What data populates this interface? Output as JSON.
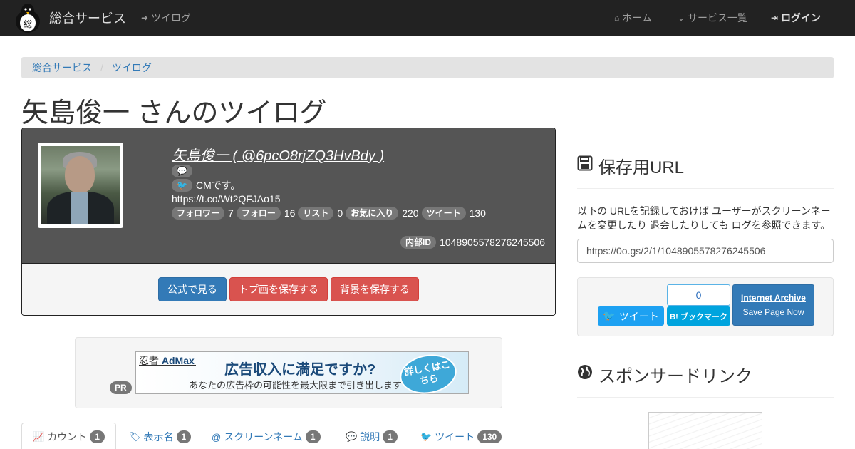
{
  "navbar": {
    "brand": "総合サービス",
    "logo_char": "総",
    "section_link": "ツイログ",
    "home": "ホーム",
    "services": "サービス一覧",
    "login": "ログイン"
  },
  "breadcrumb": {
    "root": "総合サービス",
    "current": "ツイログ"
  },
  "page_title": "矢島俊一 さんのツイログ",
  "profile": {
    "name_link": "矢島俊一 ( @6pcO8rjZQ3HvBdy )",
    "description": "CMです。",
    "url": "https://t.co/Wt2QFJAo15",
    "stats": [
      {
        "label": "フォロワー",
        "value": "7"
      },
      {
        "label": "フォロー",
        "value": "16"
      },
      {
        "label": "リスト",
        "value": "0"
      },
      {
        "label": "お気に入り",
        "value": "220"
      },
      {
        "label": "ツイート",
        "value": "130"
      }
    ],
    "internal_id_label": "内部ID",
    "internal_id": "1048905578276245506"
  },
  "actions": {
    "official": "公式で見る",
    "save_avatar": "トプ画を保存する",
    "save_background": "背景を保存する"
  },
  "ad": {
    "pr": "PR",
    "logo_a": "忍者",
    "logo_b": "AdMax",
    "headline": "広告収入に満足ですか?",
    "subline": "あなたの広告枠の可能性を最大限まで引き出します",
    "cta": "詳しくはこちら"
  },
  "tabs": [
    {
      "label": "カウント",
      "count": "1",
      "icon": "bar-chart-icon"
    },
    {
      "label": "表示名",
      "count": "1",
      "icon": "tag-icon"
    },
    {
      "label": "スクリーンネーム",
      "count": "1",
      "icon": "at-icon"
    },
    {
      "label": "説明",
      "count": "1",
      "icon": "comment-icon"
    },
    {
      "label": "ツイート",
      "count": "130",
      "icon": "twitter-icon"
    }
  ],
  "save_section": {
    "heading": "保存用URL",
    "description": "以下の URLを記録しておけば ユーザーがスクリーンネームを変更したり 退会したりしても ログを参照できます。",
    "url_value": "https://0o.gs/2/1/1048905578276245506",
    "tweet_button": "ツイート",
    "hatena_count": "0",
    "hatena_button": "B! ブックマーク",
    "ia_title": "Internet Archive",
    "ia_action": "Save Page Now"
  },
  "sponsor": {
    "heading": "スポンサードリンク"
  },
  "colors": {
    "navbar": "#222222",
    "link": "#337ab7",
    "danger": "#d9534f",
    "panel_dark": "#555555",
    "twitter": "#1da1f2",
    "hatena": "#00a4de"
  }
}
